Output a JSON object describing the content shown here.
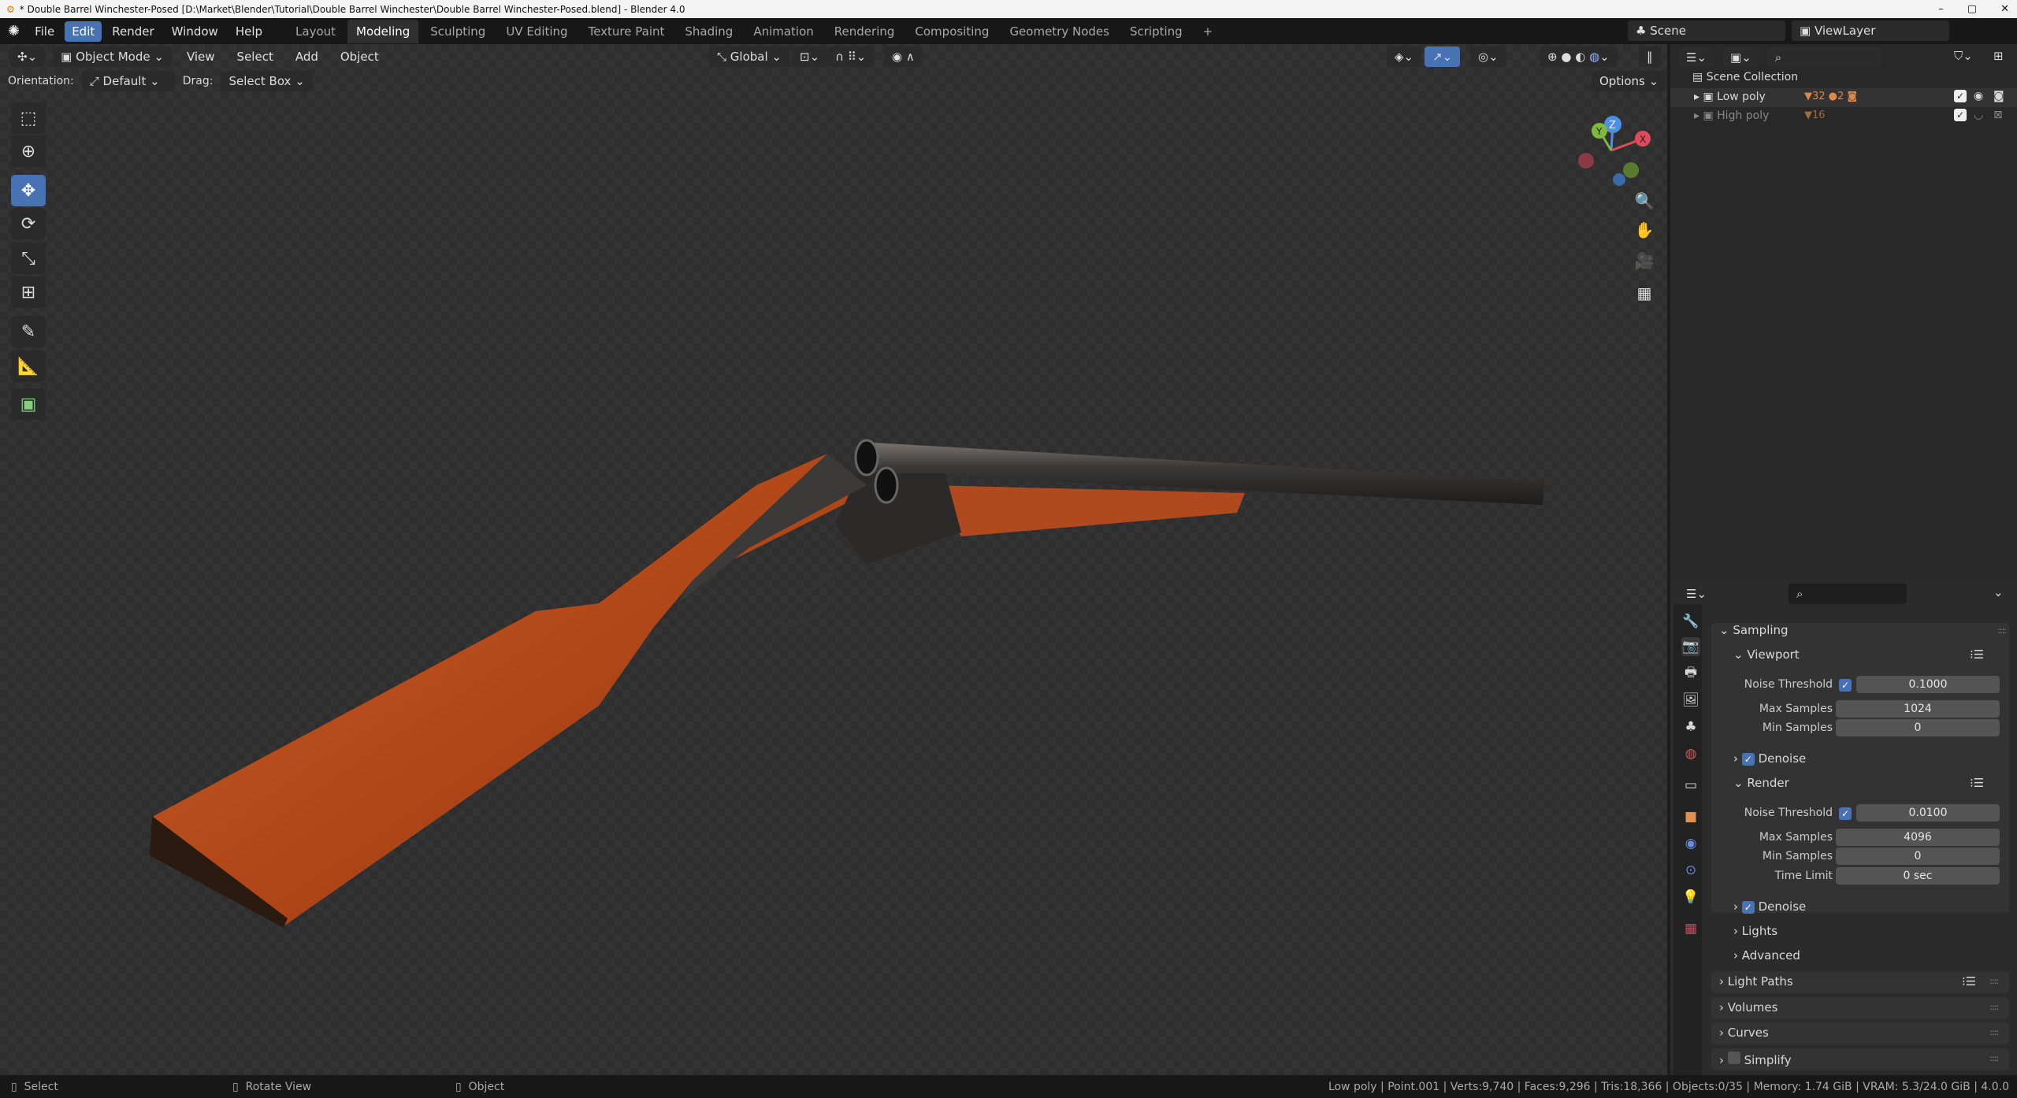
{
  "window": {
    "title": "* Double Barrel Winchester-Posed [D:\\Market\\Blender\\Tutorial\\Double Barrel Winchester\\Double Barrel Winchester-Posed.blend] - Blender 4.0",
    "controls": [
      "–",
      "▢",
      "✕"
    ]
  },
  "menu": [
    "File",
    "Edit",
    "Render",
    "Window",
    "Help"
  ],
  "workspaces": [
    "Layout",
    "Modeling",
    "Sculpting",
    "UV Editing",
    "Texture Paint",
    "Shading",
    "Animation",
    "Rendering",
    "Compositing",
    "Geometry Nodes",
    "Scripting",
    "+"
  ],
  "active_workspace": "Modeling",
  "scene": {
    "name": "Scene",
    "view_layer": "ViewLayer"
  },
  "viewport": {
    "mode": "Object Mode",
    "menus": [
      "View",
      "Select",
      "Add",
      "Object"
    ],
    "transform_orientation": "Global",
    "orientation_label": "Orientation:",
    "orientation": "Default",
    "drag_label": "Drag:",
    "drag": "Select Box",
    "options": "Options",
    "gizmo_axes": {
      "x": "X",
      "y": "Y",
      "z": "Z"
    }
  },
  "tools": [
    "select-box-icon",
    "cursor-icon",
    "move-icon",
    "rotate-icon",
    "scale-icon",
    "transform-icon",
    "annotate-icon",
    "measure-icon",
    "add-cube-icon"
  ],
  "outliner": {
    "root": "Scene Collection",
    "items": [
      {
        "name": "Low poly",
        "counts": [
          "32",
          "2"
        ]
      },
      {
        "name": "High poly",
        "counts": [
          "16"
        ]
      }
    ]
  },
  "properties": {
    "sampling": "Sampling",
    "viewport": {
      "title": "Viewport",
      "noise_label": "Noise Threshold",
      "noise": "0.1000",
      "max_label": "Max Samples",
      "max": "1024",
      "min_label": "Min Samples",
      "min": "0",
      "denoise": "Denoise"
    },
    "render": {
      "title": "Render",
      "noise_label": "Noise Threshold",
      "noise": "0.0100",
      "max_label": "Max Samples",
      "max": "4096",
      "min_label": "Min Samples",
      "min": "0",
      "time_label": "Time Limit",
      "time": "0 sec",
      "denoise": "Denoise"
    },
    "subs": [
      "Lights",
      "Advanced"
    ],
    "panels": [
      "Light Paths",
      "Volumes",
      "Curves",
      "Simplify"
    ]
  },
  "status": {
    "left": [
      {
        "icon": "mouse-left-icon",
        "label": "Select"
      },
      {
        "icon": "mouse-middle-icon",
        "label": "Rotate View"
      },
      {
        "icon": "mouse-right-icon",
        "label": "Object"
      }
    ],
    "right": "Low poly | Point.001 | Verts:9,740 | Faces:9,296 | Tris:18,366 | Objects:0/35 | Memory: 1.74 GiB | VRAM: 5.3/24.0 GiB | 4.0.0"
  },
  "colors": {
    "accent": "#4772b3",
    "wood": "#b8501c",
    "metal": "#3a3a3a"
  }
}
